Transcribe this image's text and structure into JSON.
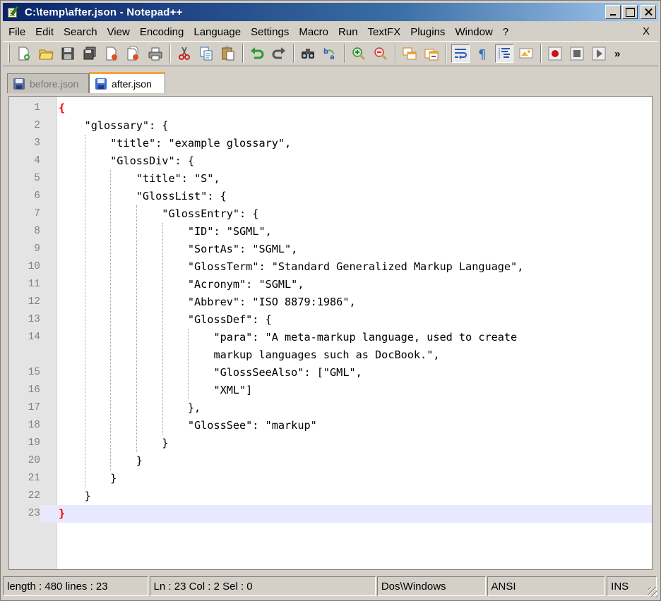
{
  "window": {
    "title": "C:\\temp\\after.json - Notepad++"
  },
  "menu": {
    "items": [
      "File",
      "Edit",
      "Search",
      "View",
      "Encoding",
      "Language",
      "Settings",
      "Macro",
      "Run",
      "TextFX",
      "Plugins",
      "Window",
      "?"
    ],
    "close": "X"
  },
  "toolbar": {
    "icons": [
      "new-file-icon",
      "open-file-icon",
      "save-icon",
      "save-all-icon",
      "close-icon",
      "close-all-icon",
      "print-icon",
      "cut-icon",
      "copy-icon",
      "paste-icon",
      "undo-icon",
      "redo-icon",
      "find-icon",
      "replace-icon",
      "zoom-in-icon",
      "zoom-out-icon",
      "sync-vertical-icon",
      "sync-horizontal-icon",
      "word-wrap-icon",
      "show-all-chars-icon",
      "indent-guide-icon",
      "user-lang-icon",
      "record-macro-icon",
      "stop-macro-icon",
      "play-macro-icon"
    ],
    "more": "»"
  },
  "tabs": [
    {
      "label": "before.json",
      "active": false
    },
    {
      "label": "after.json",
      "active": true
    }
  ],
  "editor": {
    "current_line": 23,
    "lines": [
      "{",
      "    \"glossary\": {",
      "        \"title\": \"example glossary\",",
      "        \"GlossDiv\": {",
      "            \"title\": \"S\",",
      "            \"GlossList\": {",
      "                \"GlossEntry\": {",
      "                    \"ID\": \"SGML\",",
      "                    \"SortAs\": \"SGML\",",
      "                    \"GlossTerm\": \"Standard Generalized Markup Language\",",
      "                    \"Acronym\": \"SGML\",",
      "                    \"Abbrev\": \"ISO 8879:1986\",",
      "                    \"GlossDef\": {",
      "                        \"para\": \"A meta-markup language, used to create",
      "                        markup languages such as DocBook.\",",
      "                        \"GlossSeeAlso\": [\"GML\",",
      "                        \"XML\"]",
      "                    },",
      "                    \"GlossSee\": \"markup\"",
      "                }",
      "            }",
      "        }",
      "    }",
      "}"
    ],
    "line_numbers": [
      "1",
      "2",
      "3",
      "4",
      "5",
      "6",
      "7",
      "8",
      "9",
      "10",
      "11",
      "12",
      "13",
      "14",
      "",
      "15",
      "16",
      "17",
      "18",
      "19",
      "20",
      "21",
      "22",
      "23"
    ]
  },
  "status": {
    "length_lines": "length : 480    lines : 23",
    "position": "Ln : 23    Col : 2    Sel : 0",
    "eol": "Dos\\Windows",
    "encoding": "ANSI",
    "mode": "INS"
  }
}
